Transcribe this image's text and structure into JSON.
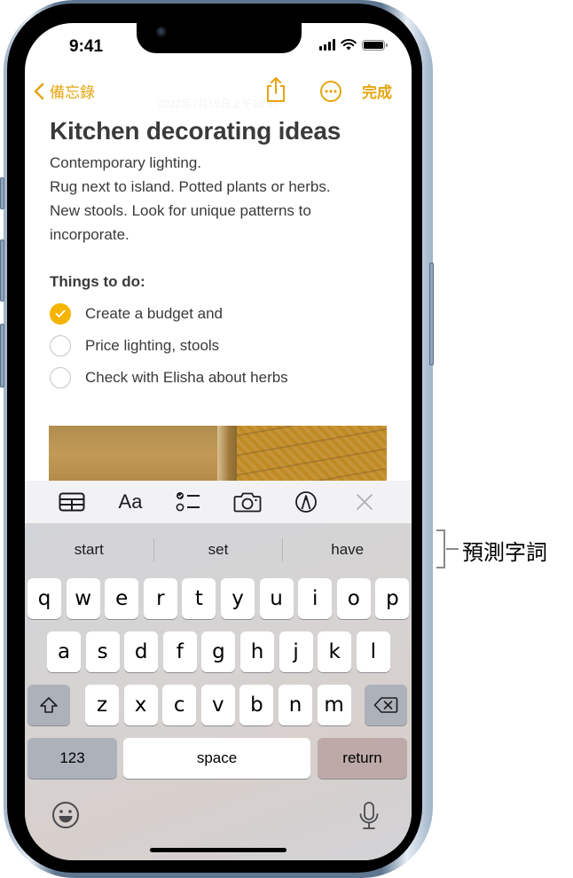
{
  "status_bar": {
    "time": "9:41"
  },
  "nav": {
    "back_label": "備忘錄",
    "date": "2022年7月10日上午10:26",
    "share_icon": "share-icon",
    "more_icon": "ellipsis-circle-icon",
    "done_label": "完成"
  },
  "note": {
    "title": "Kitchen decorating ideas",
    "body_lines": [
      "Contemporary lighting.",
      "Rug next to island.  Potted plants or herbs.",
      "New stools. Look for unique patterns to",
      "incorporate."
    ],
    "section_heading": "Things to do:",
    "checklist": [
      {
        "label": "Create a budget and",
        "checked": true
      },
      {
        "label": "Price lighting, stools",
        "checked": false
      },
      {
        "label": "Check with Elisha about herbs",
        "checked": false
      }
    ]
  },
  "toolbar": {
    "table_icon": "table-icon",
    "format_label": "Aa",
    "checklist_icon": "checklist-icon",
    "camera_icon": "camera-icon",
    "markup_icon": "markup-pen-icon",
    "close_icon": "close-icon"
  },
  "keyboard": {
    "predictions": [
      "start",
      "set",
      "have"
    ],
    "row1": [
      "q",
      "w",
      "e",
      "r",
      "t",
      "y",
      "u",
      "i",
      "o",
      "p"
    ],
    "row2": [
      "a",
      "s",
      "d",
      "f",
      "g",
      "h",
      "j",
      "k",
      "l"
    ],
    "row3": [
      "z",
      "x",
      "c",
      "v",
      "b",
      "n",
      "m"
    ],
    "numbers_label": "123",
    "space_label": "space",
    "return_label": "return"
  },
  "callout": {
    "label": "預測字詞"
  }
}
